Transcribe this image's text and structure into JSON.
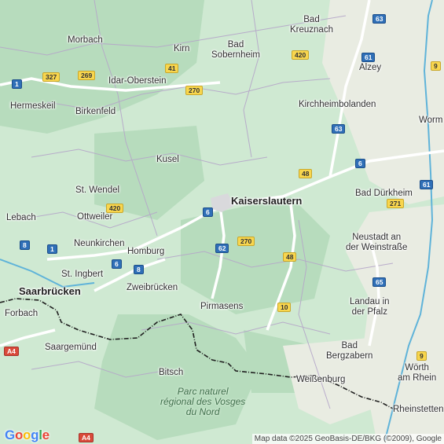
{
  "map": {
    "attribution": "Map data ©2025 GeoBasis-DE/BKG (©2009), Google",
    "logo": [
      "G",
      "o",
      "o",
      "g",
      "l",
      "e"
    ],
    "logo_colors": [
      "#4285F4",
      "#EA4335",
      "#FBBC05",
      "#4285F4",
      "#34A853",
      "#EA4335"
    ],
    "colors": {
      "forest": "#b7dcbd",
      "land": "#cfe9d2",
      "farmland": "#e9ece2",
      "river": "#5fb3d9",
      "highway": "#ffffff",
      "border": "#202020"
    },
    "cities": {
      "kaiserslautern": "Kaiserslautern",
      "bad_kreuznach": [
        "Bad",
        "Kreuznach"
      ],
      "morbach": "Morbach",
      "kirn": "Kirn",
      "bad_sobernheim": [
        "Bad",
        "Sobernheim"
      ],
      "alzey": "Alzey",
      "idar_oberstein": "Idar-Oberstein",
      "hermeskeil": "Hermeskeil",
      "birkenfeld": "Birkenfeld",
      "kirchheimbolanden": "Kirchheimbolanden",
      "worms": "Worm",
      "kusel": "Kusel",
      "st_wendel": "St. Wendel",
      "bad_durkheim": "Bad Dürkheim",
      "lebach": "Lebach",
      "ottweiler": "Ottweiler",
      "neunkirchen": "Neunkirchen",
      "homburg": "Homburg",
      "neustadt": [
        "Neustadt an",
        "der Weinstraße"
      ],
      "st_ingbert": "St. Ingbert",
      "saarbrucken": "Saarbrücken",
      "zweibrucken": "Zweibrücken",
      "pirmasens": "Pirmasens",
      "landau": [
        "Landau in",
        "der Pfalz"
      ],
      "forbach": "Forbach",
      "sarreguemines": "Saargemünd",
      "bad_bergzabern": [
        "Bad",
        "Bergzabern"
      ],
      "bitsch": "Bitsch",
      "worth": [
        "Wörth",
        "am Rhein"
      ],
      "weissenburg": "Weißenburg",
      "rheinstetten": "Rheinstetten"
    },
    "park": [
      "Parc naturel",
      "régional des Vosges",
      "du Nord"
    ],
    "shields": {
      "b63a": "63",
      "b420a": "420",
      "b61a": "61",
      "b9a": "9",
      "b327": "327",
      "b269": "269",
      "b41": "41",
      "b1a": "1",
      "b270a": "270",
      "b63b": "63",
      "b48a": "48",
      "b6a": "6",
      "b61b": "61",
      "b271": "271",
      "b420b": "420",
      "b6b": "6",
      "b8a": "8",
      "b1b": "1",
      "b270b": "270",
      "b62": "62",
      "b48b": "48",
      "b6c": "6",
      "b8b": "8",
      "b65": "65",
      "b10": "10",
      "b9b": "9",
      "a4a": "A4",
      "a4b": "A4"
    }
  }
}
